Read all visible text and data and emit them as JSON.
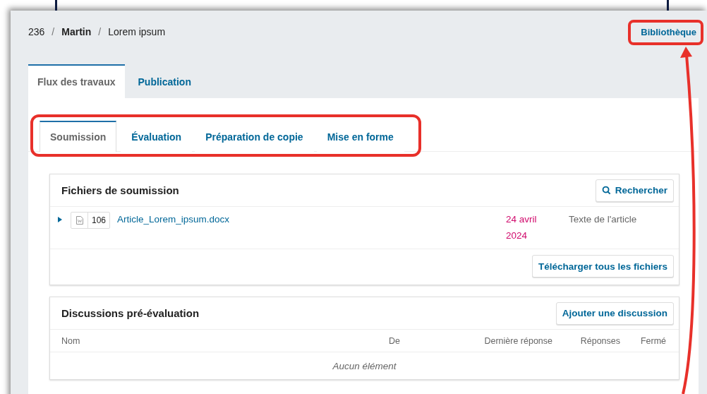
{
  "breadcrumb_separator": "/",
  "breadcrumb": [
    {
      "text": "236",
      "bold": false
    },
    {
      "text": "Martin",
      "bold": true
    },
    {
      "text": "Lorem ipsum",
      "bold": false
    }
  ],
  "library_link": "Bibliothèque",
  "main_tabs": [
    {
      "label": "Flux des travaux",
      "selected": true
    },
    {
      "label": "Publication",
      "selected": false
    }
  ],
  "stage_tabs": [
    {
      "label": "Soumission",
      "selected": true
    },
    {
      "label": "Évaluation",
      "selected": false
    },
    {
      "label": "Préparation de copie",
      "selected": false
    },
    {
      "label": "Mise en forme",
      "selected": false
    }
  ],
  "files_section": {
    "title": "Fichiers de soumission",
    "search_button": "Rechercher",
    "files": [
      {
        "number": "106",
        "name": "Article_Lorem_ipsum.docx",
        "date": "24 avril 2024",
        "type": "Texte de l'article"
      }
    ],
    "download_all_button": "Télécharger tous les fichiers"
  },
  "discussions_section": {
    "title": "Discussions pré-évaluation",
    "add_button": "Ajouter une discussion",
    "columns": [
      "Nom",
      "De",
      "Dernière réponse",
      "Réponses",
      "Fermé"
    ],
    "empty_text": "Aucun élément"
  }
}
